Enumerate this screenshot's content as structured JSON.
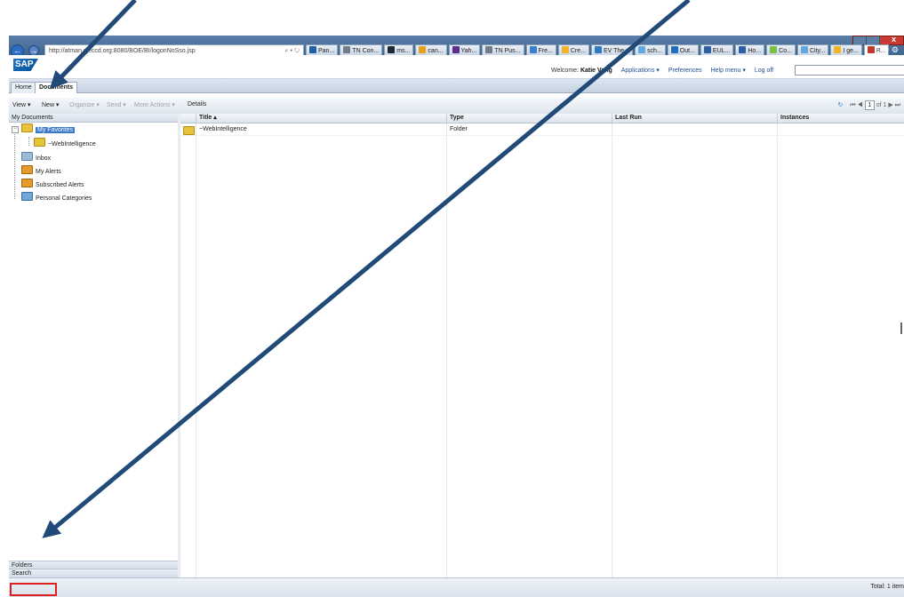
{
  "browser": {
    "address": "http://atman.sjeccd.org:8080/BOE/BI/logonNoSso.jsp",
    "address_host": "sjeccd.org",
    "address_search_glyph": "⌕ ▾ ↻",
    "back_glyph": "←",
    "forward_glyph": "→",
    "tabs": [
      {
        "label": "Pan...",
        "color": "#1f5fa8"
      },
      {
        "label": "TN Con...",
        "color": "#6f7d8c"
      },
      {
        "label": "ms...",
        "color": "#1a2a3a"
      },
      {
        "label": "can...",
        "color": "#e8a11a"
      },
      {
        "label": "Yah...",
        "color": "#5c2d91"
      },
      {
        "label": "TN Pus...",
        "color": "#6f7d8c"
      },
      {
        "label": "Fre...",
        "color": "#3a7fd0"
      },
      {
        "label": "Cre...",
        "color": "#f0b428"
      },
      {
        "label": "EV The...",
        "color": "#2b7cc3"
      },
      {
        "label": "sch...",
        "color": "#62a8e0"
      },
      {
        "label": "Out...",
        "color": "#1f6fc0"
      },
      {
        "label": "EUL...",
        "color": "#2d5ea8"
      },
      {
        "label": "Ho...",
        "color": "#2d5ea8"
      },
      {
        "label": "Co...",
        "color": "#7bc043"
      },
      {
        "label": "City...",
        "color": "#62a8e0"
      },
      {
        "label": "I ge...",
        "color": "#f0b428"
      },
      {
        "label": "B...",
        "color": "#c0392b",
        "active": true
      }
    ],
    "right_icons": "⌂ ☆ ⚙"
  },
  "sap_header": {
    "logo": "SAP",
    "welcome_prefix": "Welcome:",
    "user_name": "Katie Vang",
    "links": [
      "Applications ▾",
      "Preferences",
      "Help menu ▾",
      "Log off"
    ]
  },
  "app_tabs": [
    "Home",
    "Documents"
  ],
  "toolbar": {
    "items": [
      {
        "label": "View ▾",
        "disabled": false
      },
      {
        "label": "New ▾",
        "disabled": false
      },
      {
        "label": "Organize ▾",
        "disabled": true
      },
      {
        "label": "Send ▾",
        "disabled": true
      },
      {
        "label": "More Actions ▾",
        "disabled": true
      },
      {
        "label": "Details",
        "disabled": false
      }
    ],
    "pager": {
      "first": "⏮",
      "prev": "◀",
      "page": "1",
      "of_label": "of 1",
      "next": "▶",
      "last": "⏭",
      "refresh": "↻"
    }
  },
  "left_panel": {
    "header": "My Documents",
    "tree": [
      {
        "label": "My Favorites",
        "icon": "folder",
        "selected": true
      },
      {
        "label": "~WebIntelligence",
        "icon": "folder",
        "selected": false
      },
      {
        "label": "Inbox",
        "icon": "inbox",
        "selected": false
      },
      {
        "label": "My Alerts",
        "icon": "alert",
        "selected": false
      },
      {
        "label": "Subscribed Alerts",
        "icon": "alert",
        "selected": false
      },
      {
        "label": "Personal Categories",
        "icon": "cat",
        "selected": false
      }
    ],
    "expander_glyph": "−",
    "folders_label": "Folders",
    "search_label": "Search"
  },
  "grid": {
    "columns": [
      "Title ▴",
      "Type",
      "Last Run",
      "Instances"
    ],
    "rows": [
      {
        "title": "~WebIntelligence",
        "type": "Folder",
        "last_run": "",
        "instances": ""
      }
    ]
  },
  "status": {
    "total": "Total: 1 item"
  },
  "annotation": {
    "arrow_color": "#214a78",
    "box_color": "#e02020"
  }
}
